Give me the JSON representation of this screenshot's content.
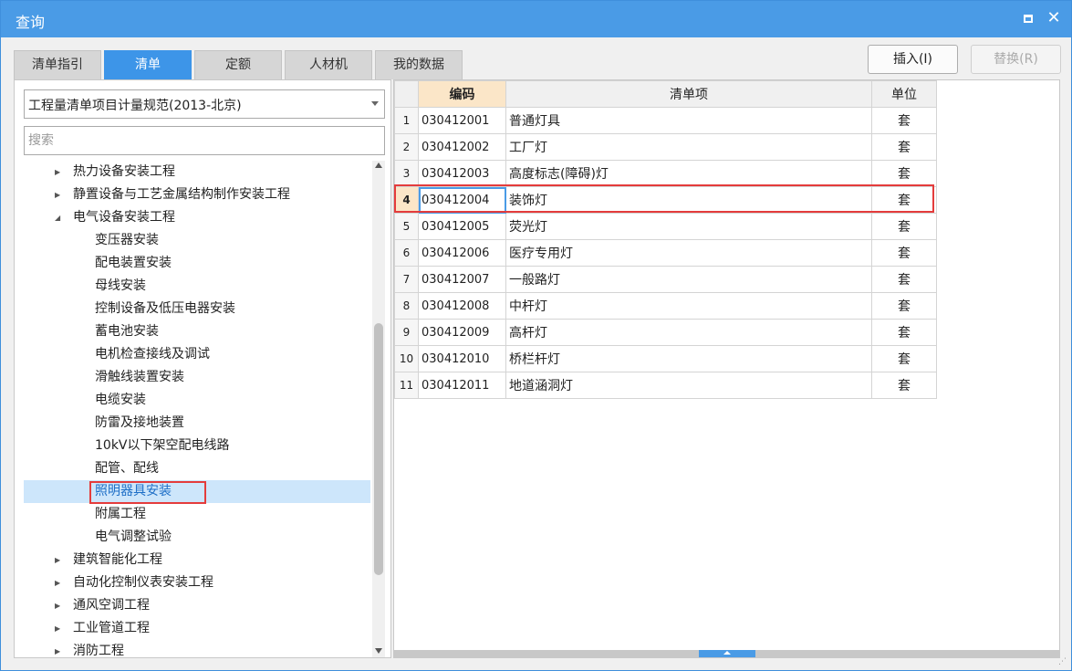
{
  "window": {
    "title": "查询",
    "maximize_icon": "maximize-icon",
    "close_icon": "close-icon",
    "close_glyph": "✕"
  },
  "tabs": [
    {
      "label": "清单指引",
      "active": false
    },
    {
      "label": "清单",
      "active": true
    },
    {
      "label": "定额",
      "active": false
    },
    {
      "label": "人材机",
      "active": false
    },
    {
      "label": "我的数据",
      "active": false
    }
  ],
  "actions": {
    "insert_label": "插入(I)",
    "replace_label": "替换(R)"
  },
  "left": {
    "combo_value": "工程量清单项目计量规范(2013-北京)",
    "search_placeholder": "搜索",
    "tree": [
      {
        "label": "热力设备安装工程",
        "level": 0,
        "expander": "collapsed"
      },
      {
        "label": "静置设备与工艺金属结构制作安装工程",
        "level": 0,
        "expander": "collapsed"
      },
      {
        "label": "电气设备安装工程",
        "level": 0,
        "expander": "expanded"
      },
      {
        "label": "变压器安装",
        "level": 1
      },
      {
        "label": "配电装置安装",
        "level": 1
      },
      {
        "label": "母线安装",
        "level": 1
      },
      {
        "label": "控制设备及低压电器安装",
        "level": 1
      },
      {
        "label": "蓄电池安装",
        "level": 1
      },
      {
        "label": "电机检查接线及调试",
        "level": 1
      },
      {
        "label": "滑触线装置安装",
        "level": 1
      },
      {
        "label": "电缆安装",
        "level": 1
      },
      {
        "label": "防雷及接地装置",
        "level": 1
      },
      {
        "label": "10kV以下架空配电线路",
        "level": 1
      },
      {
        "label": "配管、配线",
        "level": 1
      },
      {
        "label": "照明器具安装",
        "level": 1,
        "selected": true
      },
      {
        "label": "附属工程",
        "level": 1
      },
      {
        "label": "电气调整试验",
        "level": 1
      },
      {
        "label": "建筑智能化工程",
        "level": 0,
        "expander": "collapsed"
      },
      {
        "label": "自动化控制仪表安装工程",
        "level": 0,
        "expander": "collapsed"
      },
      {
        "label": "通风空调工程",
        "level": 0,
        "expander": "collapsed"
      },
      {
        "label": "工业管道工程",
        "level": 0,
        "expander": "collapsed"
      },
      {
        "label": "消防工程",
        "level": 0,
        "expander": "collapsed"
      }
    ]
  },
  "table": {
    "headers": {
      "code": "编码",
      "name": "清单项",
      "unit": "单位"
    },
    "rows": [
      {
        "num": "1",
        "code": "030412001",
        "name": "普通灯具",
        "unit": "套"
      },
      {
        "num": "2",
        "code": "030412002",
        "name": "工厂灯",
        "unit": "套"
      },
      {
        "num": "3",
        "code": "030412003",
        "name": "高度标志(障碍)灯",
        "unit": "套"
      },
      {
        "num": "4",
        "code": "030412004",
        "name": "装饰灯",
        "unit": "套",
        "current": true
      },
      {
        "num": "5",
        "code": "030412005",
        "name": "荧光灯",
        "unit": "套"
      },
      {
        "num": "6",
        "code": "030412006",
        "name": "医疗专用灯",
        "unit": "套"
      },
      {
        "num": "7",
        "code": "030412007",
        "name": "一般路灯",
        "unit": "套"
      },
      {
        "num": "8",
        "code": "030412008",
        "name": "中杆灯",
        "unit": "套"
      },
      {
        "num": "9",
        "code": "030412009",
        "name": "高杆灯",
        "unit": "套"
      },
      {
        "num": "10",
        "code": "030412010",
        "name": "桥栏杆灯",
        "unit": "套"
      },
      {
        "num": "11",
        "code": "030412011",
        "name": "地道涵洞灯",
        "unit": "套"
      }
    ]
  },
  "colors": {
    "titlebar": "#4a9be6",
    "active_tab": "#3d95e8",
    "selection": "#cde6fb",
    "highlight_box": "#e43c3c",
    "header_current": "#fbe6c8"
  }
}
